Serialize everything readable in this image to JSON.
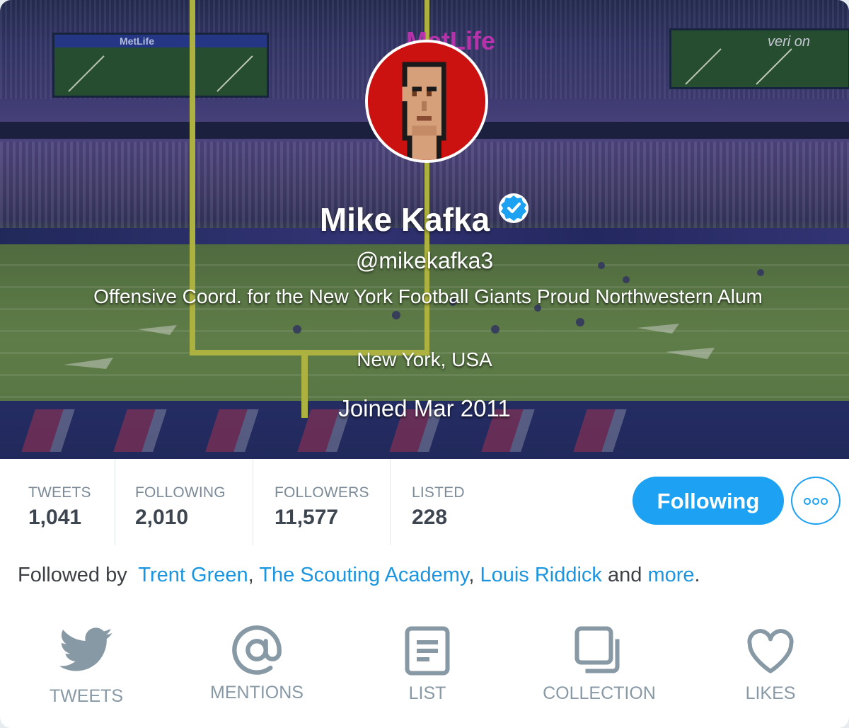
{
  "profile": {
    "name": "Mike Kafka",
    "handle": "@mikekafka3",
    "bio": "Offensive Coord. for the New York Football Giants Proud Northwestern Alum",
    "location": "New York, USA",
    "joined": "Joined Mar 2011",
    "verified": true
  },
  "banner": {
    "signage": [
      "MetLife",
      "MetLife",
      "veri on"
    ]
  },
  "stats": [
    {
      "label": "TWEETS",
      "value": "1,041"
    },
    {
      "label": "FOLLOWING",
      "value": "2,010"
    },
    {
      "label": "FOLLOWERS",
      "value": "11,577"
    },
    {
      "label": "LISTED",
      "value": "228"
    }
  ],
  "actions": {
    "follow_label": "Following",
    "more_icon": "ellipsis-icon"
  },
  "followed_by": {
    "prefix": "Followed by",
    "people": [
      "Trent Green",
      "The Scouting Academy",
      "Louis Riddick"
    ],
    "sep": ",",
    "and": "and",
    "more": "more",
    "end": "."
  },
  "nav": [
    {
      "label": "TWEETS",
      "icon": "bird-icon"
    },
    {
      "label": "MENTIONS",
      "icon": "at-sign-icon"
    },
    {
      "label": "LIST",
      "icon": "list-icon"
    },
    {
      "label": "COLLECTION",
      "icon": "collection-icon"
    },
    {
      "label": "LIKES",
      "icon": "heart-icon"
    }
  ],
  "colors": {
    "accent": "#1da1f2",
    "link": "#1b95e0",
    "muted": "#8899a6",
    "avatar_bg": "#cc1111"
  }
}
